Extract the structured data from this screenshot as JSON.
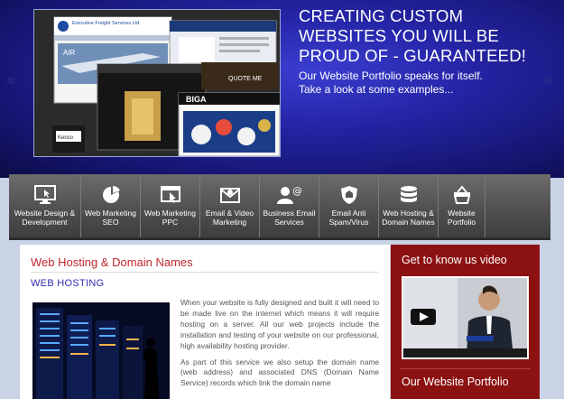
{
  "hero": {
    "title": "CREATING CUSTOM WEBSITES YOU WILL BE PROUD OF - GUARANTEED!",
    "subtitle_line1": "Our Website Portfolio speaks for itself.",
    "subtitle_line2": "Take a look at some examples...",
    "prev_arrow": "«",
    "next_arrow": "»",
    "shot_labels": {
      "efs": "Executive Freight Services Ltd",
      "air": "AIR",
      "quote": "QUOTE ME",
      "biga": "BIGA",
      "kenco": "Kenco"
    }
  },
  "nav": {
    "items": [
      {
        "label": "Website Design & Development",
        "icon": "monitor-icon"
      },
      {
        "label": "Web Marketing SEO",
        "icon": "pie-chart-icon"
      },
      {
        "label": "Web Marketing PPC",
        "icon": "browser-cursor-icon"
      },
      {
        "label": "Email & Video Marketing",
        "icon": "envelope-icon"
      },
      {
        "label": "Business Email Services",
        "icon": "user-at-icon"
      },
      {
        "label": "Email Anti Spam/Virus",
        "icon": "shield-icon"
      },
      {
        "label": "Web Hosting & Domain Names",
        "icon": "database-icon"
      },
      {
        "label": "Website Portfolio",
        "icon": "basket-icon"
      }
    ]
  },
  "content": {
    "title": "Web Hosting & Domain Names",
    "subheading": "WEB HOSTING",
    "para1": "When your website is fully designed and built it will need to be made live on the internet which means it will require hosting on a server.  All our web projects include the installation and testing of your website on our professional, high availability hosting provider.",
    "para2": "As part of this service we also setup the domain name (web address) and associated DNS (Domain Name Service) records which link the domain name"
  },
  "sidebar": {
    "video_title": "Get to know us video",
    "portfolio_title": "Our Website Portfolio"
  },
  "colors": {
    "accent_red": "#c1272d",
    "link_blue": "#2d2db4",
    "sidebar_red": "#8c1111",
    "hero_blue": "#2525a8"
  }
}
